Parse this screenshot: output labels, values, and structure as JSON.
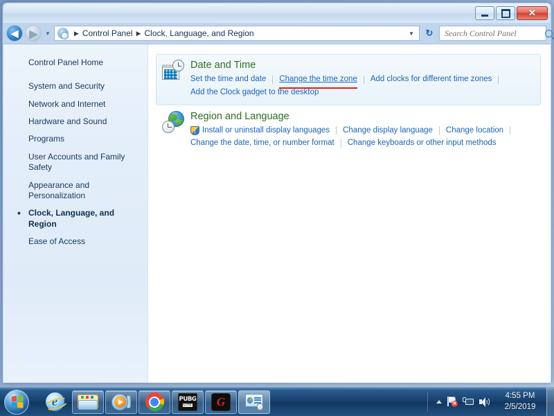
{
  "window": {
    "minimize_label": "",
    "maximize_label": "",
    "close_label": "✕"
  },
  "nav": {
    "back_glyph": "◀",
    "forward_glyph": "▶",
    "dropdown_glyph": "▼",
    "refresh_glyph": "↻",
    "breadcrumb": {
      "root": "Control Panel",
      "current": "Clock, Language, and Region",
      "separator": "▶",
      "caret": "▼"
    }
  },
  "search": {
    "placeholder": "Search Control Panel",
    "value": ""
  },
  "sidebar": {
    "home_label": "Control Panel Home",
    "items": [
      {
        "label": "System and Security"
      },
      {
        "label": "Network and Internet"
      },
      {
        "label": "Hardware and Sound"
      },
      {
        "label": "Programs"
      },
      {
        "label": "User Accounts and Family Safety"
      },
      {
        "label": "Appearance and Personalization"
      },
      {
        "label": "Clock, Language, and Region"
      },
      {
        "label": "Ease of Access"
      }
    ],
    "active_index": 6
  },
  "content": {
    "groups": [
      {
        "title": "Date and Time",
        "icon": "date-time-icon",
        "links_row1": [
          {
            "label": "Set the time and date",
            "state": "normal"
          },
          {
            "label": "Change the time zone",
            "state": "hover-annotated"
          },
          {
            "label": "Add clocks for different time zones",
            "state": "normal"
          }
        ],
        "links_row2": [
          {
            "label": "Add the Clock gadget to the desktop",
            "state": "normal"
          }
        ]
      },
      {
        "title": "Region and Language",
        "icon": "region-language-icon",
        "links_row1": [
          {
            "label": "Install or uninstall display languages",
            "state": "normal",
            "shield": true
          },
          {
            "label": "Change display language",
            "state": "normal"
          },
          {
            "label": "Change location",
            "state": "normal"
          }
        ],
        "links_row2": [
          {
            "label": "Change the date, time, or number format",
            "state": "normal"
          },
          {
            "label": "Change keyboards or other input methods",
            "state": "normal"
          }
        ]
      }
    ]
  },
  "taskbar": {
    "start_label": "Start",
    "buttons": [
      {
        "name": "internet-explorer",
        "label": "Internet Explorer",
        "glyph": "e"
      },
      {
        "name": "windows-explorer",
        "label": "Windows Explorer"
      },
      {
        "name": "windows-media-player",
        "label": "Windows Media Player"
      },
      {
        "name": "google-chrome",
        "label": "Google Chrome"
      },
      {
        "name": "pubg-lite",
        "label": "PUBG LITE",
        "line1": "PUBG",
        "line2": "LITE"
      },
      {
        "name": "garena",
        "label": "Garena",
        "glyph": "G"
      },
      {
        "name": "control-panel",
        "label": "Control Panel"
      }
    ]
  },
  "tray": {
    "action_center_badge": "✕",
    "clock_time": "4:55 PM",
    "clock_date": "2/5/2019"
  },
  "colors": {
    "link": "#1a64b8",
    "group_title": "#2f6e23",
    "annotation": "#e81b0c",
    "sidebar_text": "#16395c"
  }
}
